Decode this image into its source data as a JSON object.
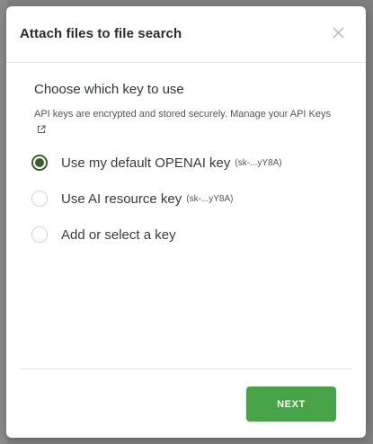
{
  "dialog": {
    "title": "Attach files to file search",
    "close_icon": "close-icon"
  },
  "key_section": {
    "title": "Choose which key to use",
    "help_text": "API keys are encrypted and stored securely. Manage your ",
    "help_link": "API Keys",
    "link_icon": "external-link-icon"
  },
  "options": [
    {
      "label": "Use my default OPENAI key",
      "key_hint": "(sk-...yY8A)",
      "selected": true
    },
    {
      "label": "Use AI resource key",
      "key_hint": "(sk-...yY8A)",
      "selected": false
    },
    {
      "label": "Add or select a key",
      "key_hint": "",
      "selected": false
    }
  ],
  "footer": {
    "next_label": "NEXT"
  },
  "colors": {
    "accent_green": "#48a248",
    "radio_selected": "#3c5d2c"
  }
}
